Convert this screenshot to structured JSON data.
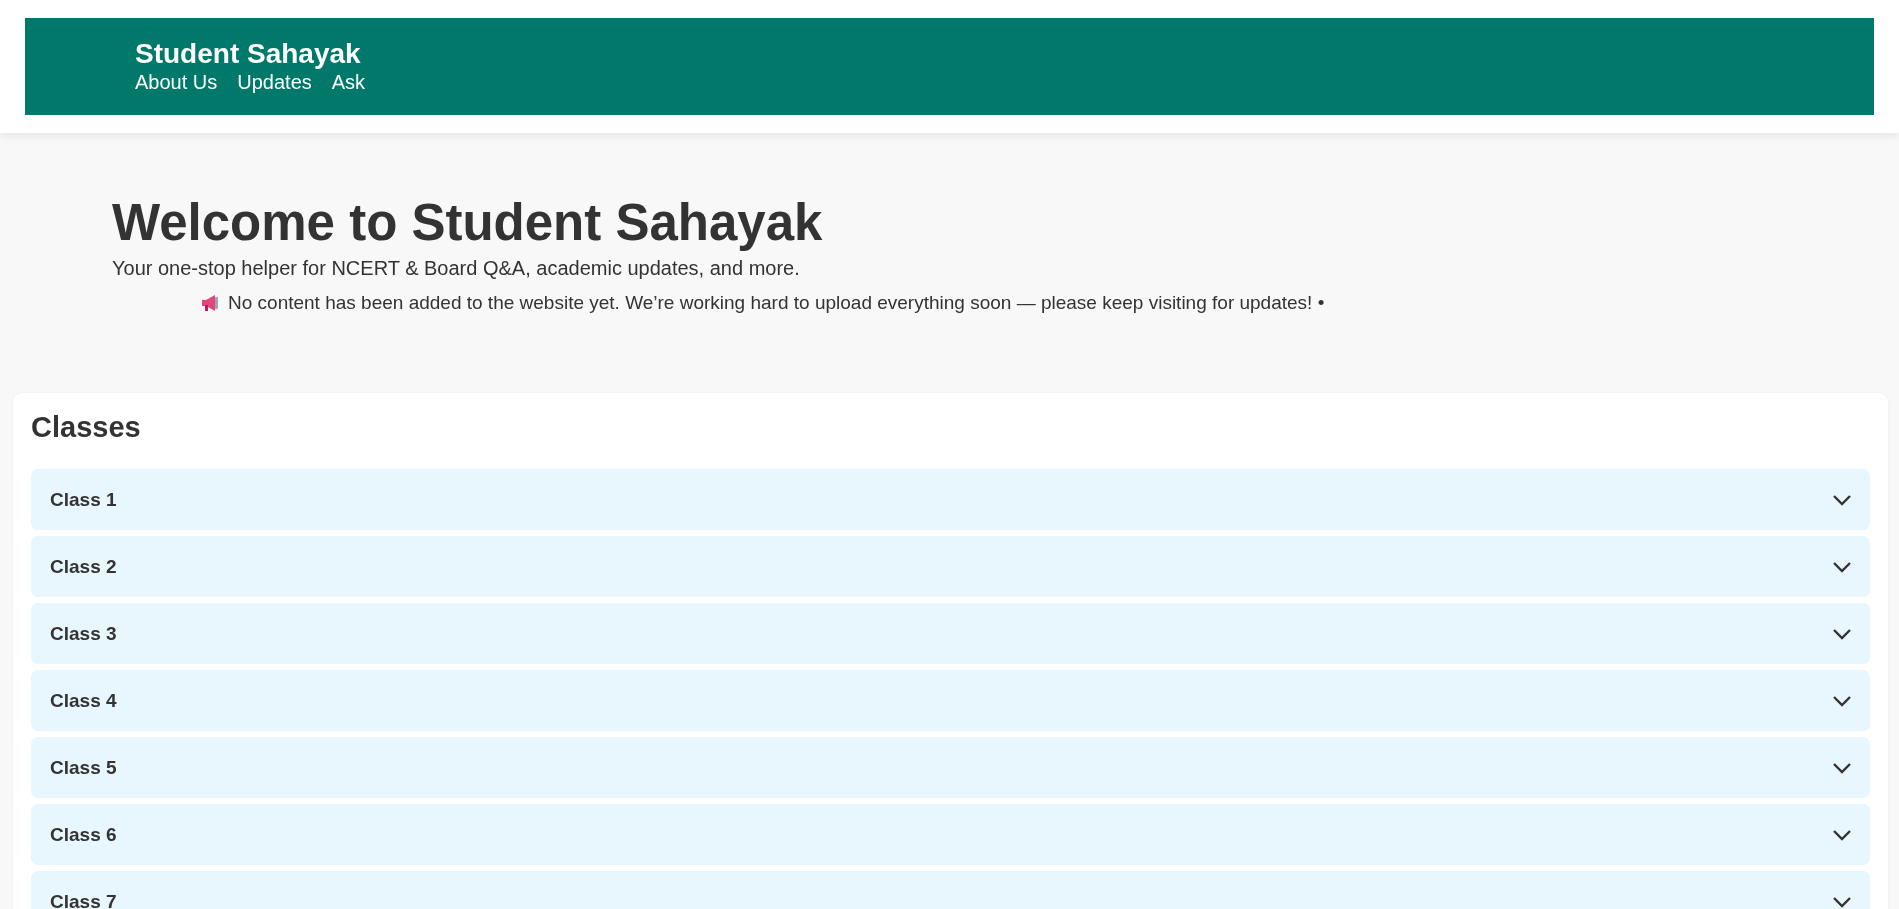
{
  "header": {
    "title": "Student Sahayak",
    "nav": [
      {
        "label": "About Us"
      },
      {
        "label": "Updates"
      },
      {
        "label": "Ask"
      }
    ]
  },
  "hero": {
    "title": "Welcome to Student Sahayak",
    "subtitle": "Your one-stop helper for NCERT & Board Q&A, academic updates, and more.",
    "notice": "No content has been added to the website yet. We’re working hard to upload everything soon — please keep visiting for updates! •"
  },
  "classes": {
    "title": "Classes",
    "items": [
      {
        "label": "Class 1",
        "expanded": false
      },
      {
        "label": "Class 2",
        "expanded": false
      },
      {
        "label": "Class 3",
        "expanded": false
      },
      {
        "label": "Class 4",
        "expanded": false
      },
      {
        "label": "Class 5",
        "expanded": false
      },
      {
        "label": "Class 6",
        "expanded": false
      },
      {
        "label": "Class 7",
        "expanded": false
      }
    ]
  }
}
